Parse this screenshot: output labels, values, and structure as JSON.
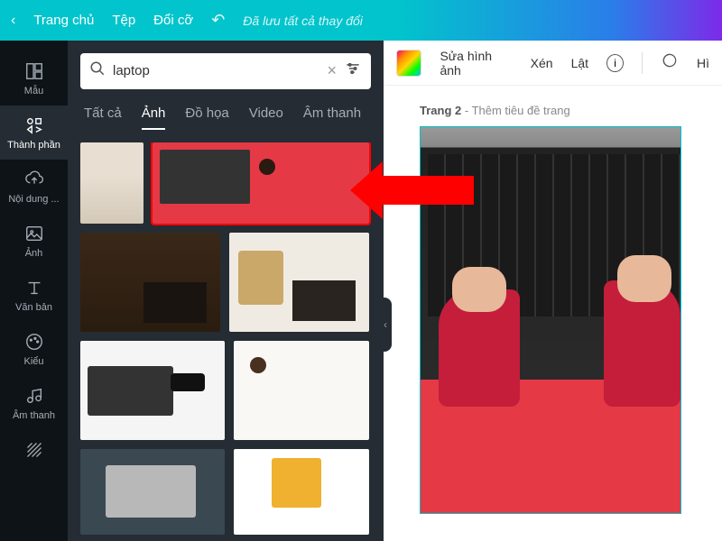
{
  "topbar": {
    "home": "Trang chủ",
    "file": "Tệp",
    "resize": "Đổi cỡ",
    "saved": "Đã lưu tất cả thay đổi"
  },
  "sidebar": {
    "templates": "Mẫu",
    "elements": "Thành phần",
    "uploads": "Nội dung ...",
    "photos": "Ảnh",
    "text": "Văn bản",
    "styles": "Kiểu",
    "audio": "Âm thanh"
  },
  "search": {
    "value": "laptop"
  },
  "tabs": {
    "all": "Tất cả",
    "photos": "Ảnh",
    "graphics": "Đồ họa",
    "video": "Video",
    "audio": "Âm thanh"
  },
  "toolbar": {
    "edit_image": "Sửa hình ảnh",
    "crop": "Xén",
    "flip": "Lật",
    "filter_prefix": "Hì"
  },
  "page": {
    "label_bold": "Trang 2",
    "label_rest": " - Thêm tiêu đề trang"
  }
}
